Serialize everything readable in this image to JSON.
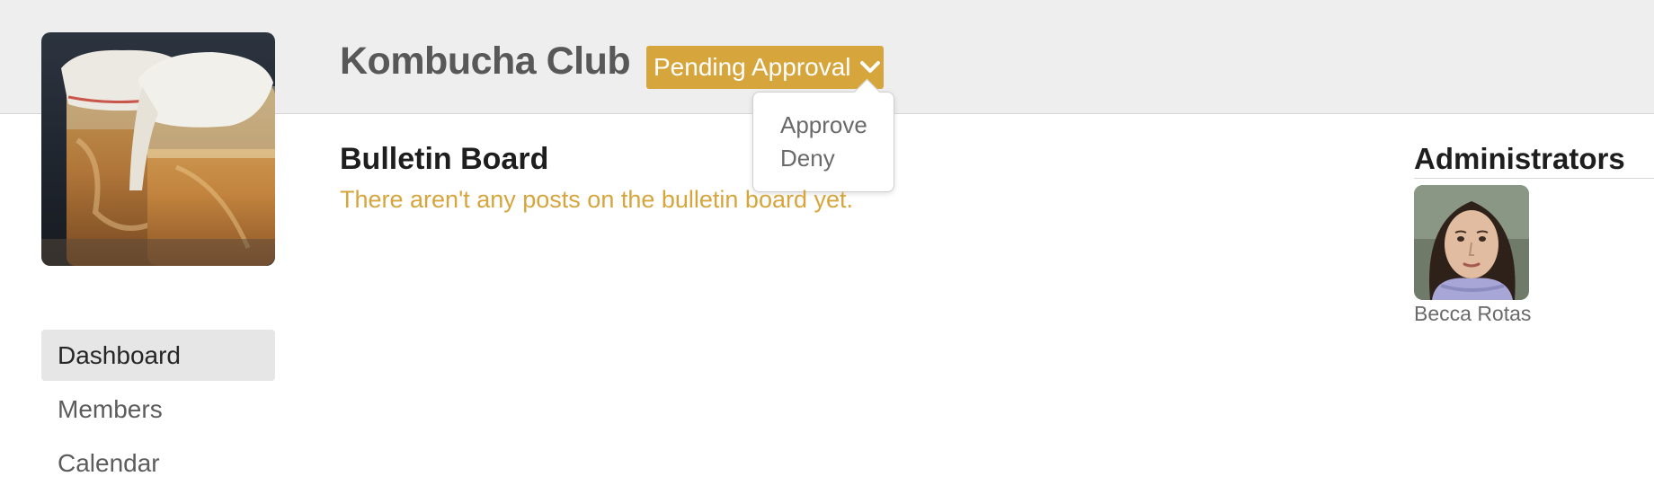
{
  "group": {
    "title": "Kombucha Club",
    "status_label": "Pending Approval",
    "status_color": "#d6a53c",
    "status_options": [
      "Approve",
      "Deny"
    ],
    "photo": "kombucha-jars-photo"
  },
  "bulletin": {
    "title": "Bulletin Board",
    "empty_message": "There aren't any posts on the bulletin board yet."
  },
  "nav": {
    "items": [
      {
        "label": "Dashboard",
        "active": true
      },
      {
        "label": "Members",
        "active": false
      },
      {
        "label": "Calendar",
        "active": false
      }
    ]
  },
  "administrators": {
    "title": "Administrators",
    "people": [
      {
        "name": "Becca Rotas",
        "avatar": "avatar-photo"
      }
    ]
  },
  "colors": {
    "header_bg": "#eeeeee",
    "accent": "#d6a53c",
    "nav_active_bg": "#e6e6e6"
  }
}
